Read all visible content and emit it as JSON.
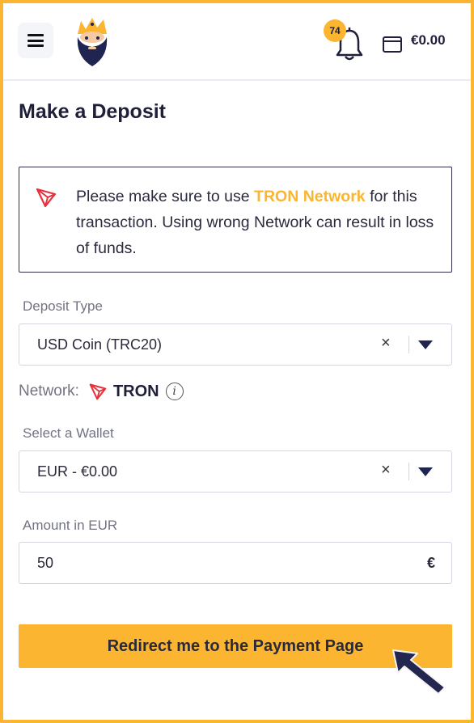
{
  "header": {
    "notification_count": "74",
    "balance": "€0.00",
    "icons": [
      "hamburger-menu-icon",
      "king-logo",
      "bell-icon",
      "wallet-icon"
    ]
  },
  "page": {
    "title": "Make a Deposit"
  },
  "notice": {
    "text_before": "Please make sure to use ",
    "highlight": "TRON Network",
    "text_after": " for this transaction. Using wrong Network can result in loss of funds.",
    "highlight_color": "#fbb531"
  },
  "deposit_type": {
    "label": "Deposit Type",
    "value": "USD Coin (TRC20)",
    "clear": "×"
  },
  "network": {
    "label": "Network:",
    "value": "TRON",
    "info_glyph": "i"
  },
  "wallet": {
    "label": "Select a Wallet",
    "value": "EUR - €0.00",
    "clear": "×"
  },
  "amount": {
    "label": "Amount in EUR",
    "value": "50",
    "currency_symbol": "€"
  },
  "submit": {
    "label": "Redirect me to the Payment Page"
  },
  "colors": {
    "accent": "#fbb531",
    "tron_red": "#e8303c",
    "dark": "#1f1f3a"
  }
}
